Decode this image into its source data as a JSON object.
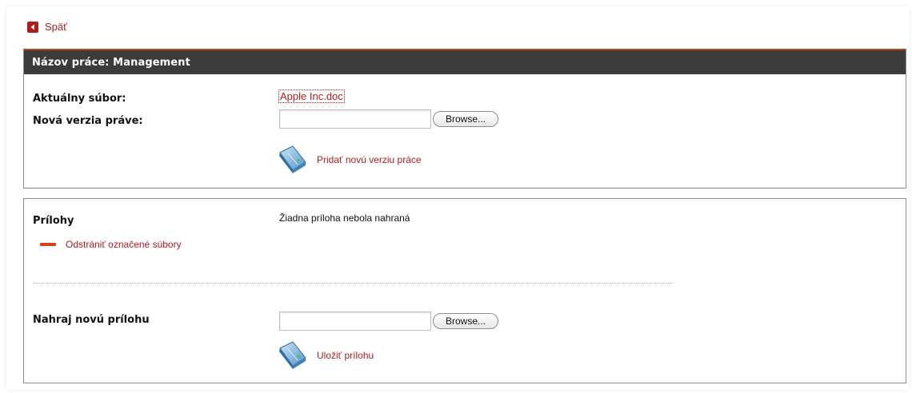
{
  "back": {
    "label": "Späť"
  },
  "work": {
    "header": "Názov práce: Management",
    "current_file_label": "Aktuálny súbor:",
    "current_file_name": "Apple Inc.doc",
    "new_version_label": "Nová verzia práve:",
    "browse_label": "Browse...",
    "add_version_label": "Pridať novú verziu práce"
  },
  "attachments": {
    "title": "Prílohy",
    "empty_text": "Žiadna príloha nebola nahraná",
    "remove_label": "Odstrániť označené súbory",
    "upload_label": "Nahraj novú prílohu",
    "browse_label": "Browse...",
    "save_label": "Uložiť prílohu"
  },
  "colors": {
    "link": "#b01d1d",
    "header_bg": "#3b3b3b",
    "accent": "#b9471f",
    "remove_icon": "#d6401b"
  },
  "icons": {
    "back": "back-arrow-icon",
    "document": "document-icon",
    "remove": "minus-icon"
  }
}
